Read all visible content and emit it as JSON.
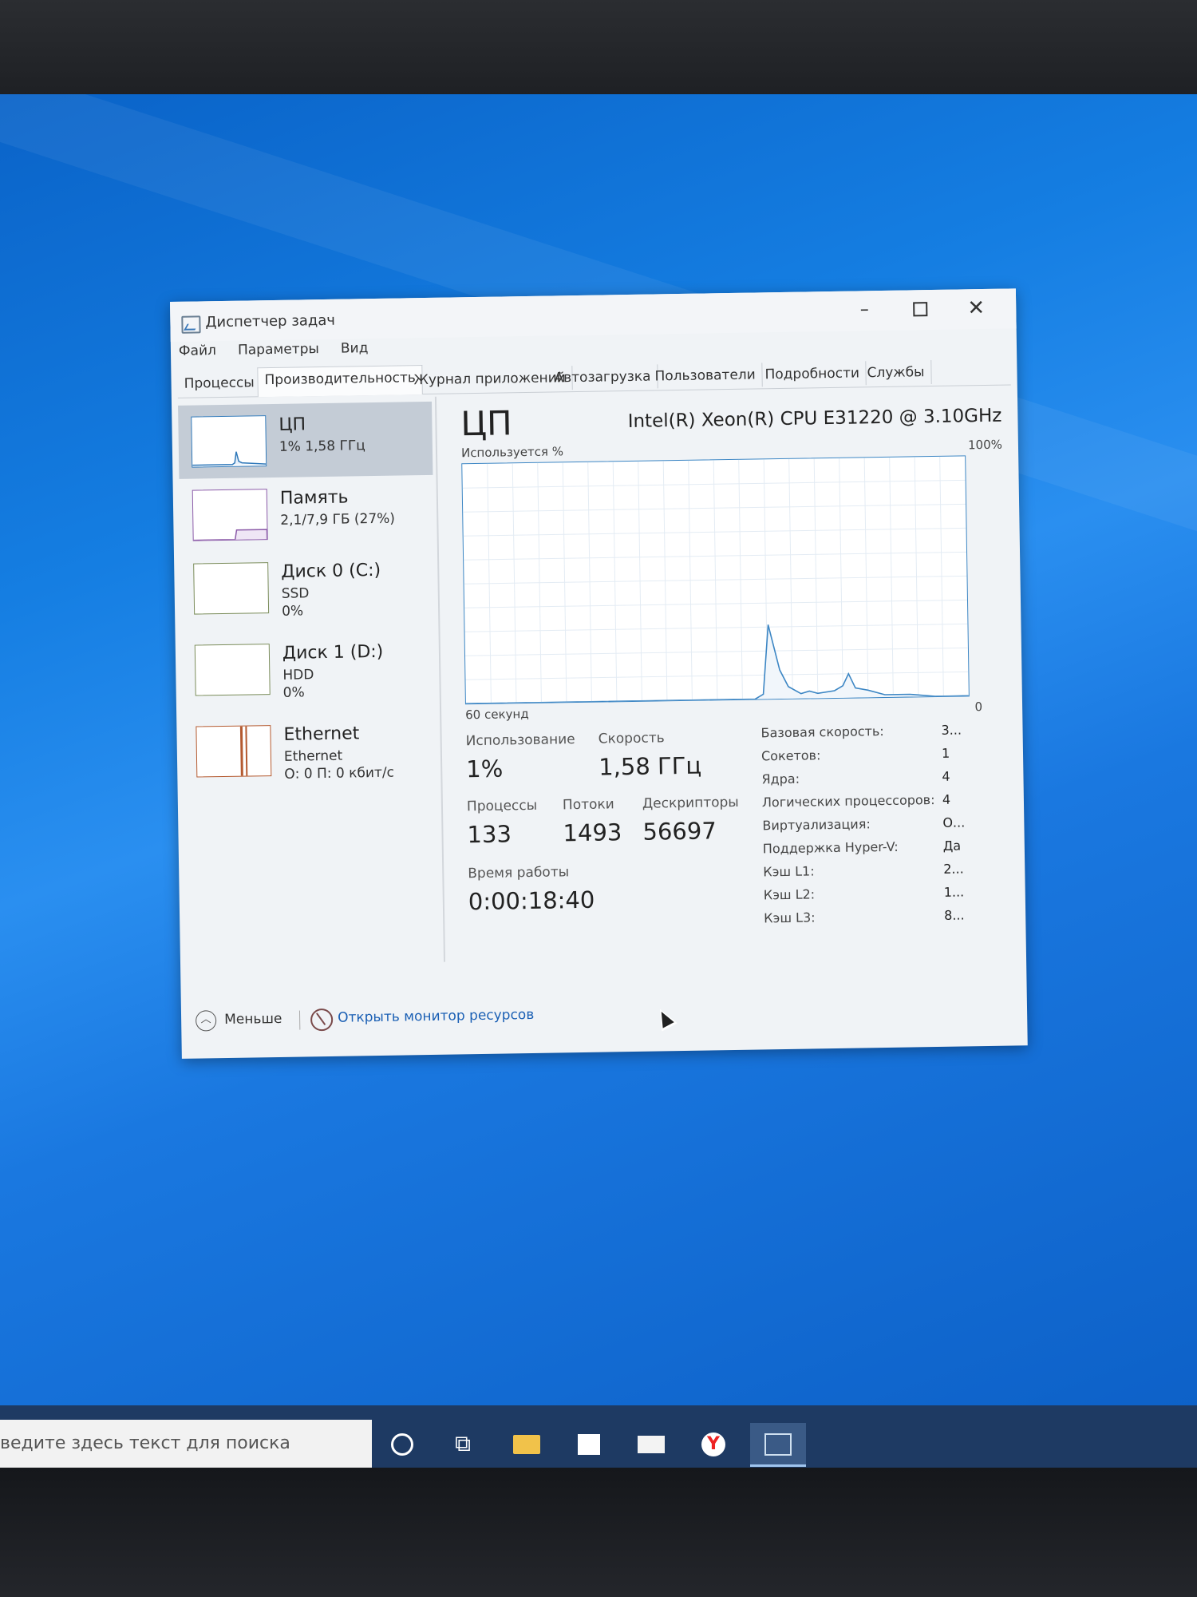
{
  "window": {
    "title": "Диспетчер задач",
    "controls": {
      "minimize": "–",
      "close": "✕"
    }
  },
  "menu": [
    "Файл",
    "Параметры",
    "Вид"
  ],
  "tabs": [
    "Процессы",
    "Производительность",
    "Журнал приложений",
    "Автозагрузка",
    "Пользователи",
    "Подробности",
    "Службы"
  ],
  "active_tab": "Производительность",
  "resources": [
    {
      "name": "ЦП",
      "line2": "1% 1,58 ГГц",
      "line3": ""
    },
    {
      "name": "Память",
      "line2": "2,1/7,9 ГБ (27%)",
      "line3": ""
    },
    {
      "name": "Диск 0 (C:)",
      "line2": "SSD",
      "line3": "0%"
    },
    {
      "name": "Диск 1 (D:)",
      "line2": "HDD",
      "line3": "0%"
    },
    {
      "name": "Ethernet",
      "line2": "Ethernet",
      "line3": "О: 0 П: 0 кбит/с"
    }
  ],
  "cpu": {
    "title": "ЦП",
    "model": "Intel(R) Xeon(R) CPU E31220 @ 3.10GHz",
    "used_label": "Используется %",
    "max_label": "100%",
    "time_label": "60 секунд",
    "min_label": "0"
  },
  "chart_data": {
    "type": "line",
    "x": [
      0,
      2,
      4,
      6,
      8,
      10,
      12,
      14,
      16,
      18,
      20,
      22,
      24,
      26,
      28,
      30,
      32,
      34,
      36,
      38,
      40,
      42,
      44,
      46,
      48,
      50,
      52,
      54,
      56,
      58,
      60
    ],
    "series": [
      {
        "values": [
          0,
          0,
          0,
          0,
          0,
          0,
          0,
          0,
          0,
          0,
          0,
          0,
          0,
          0,
          0,
          0,
          0,
          0,
          0,
          0,
          0,
          0,
          0,
          0,
          0,
          0,
          0,
          0,
          0,
          0,
          0
        ]
      }
    ],
    "detail_points": [
      {
        "x": 0,
        "y": 0
      },
      {
        "x": 34.5,
        "y": 0
      },
      {
        "x": 35.5,
        "y": 2
      },
      {
        "x": 36.2,
        "y": 31
      },
      {
        "x": 37.5,
        "y": 12
      },
      {
        "x": 38.5,
        "y": 5
      },
      {
        "x": 40,
        "y": 2
      },
      {
        "x": 41,
        "y": 3
      },
      {
        "x": 42,
        "y": 2
      },
      {
        "x": 44,
        "y": 3
      },
      {
        "x": 45,
        "y": 5
      },
      {
        "x": 45.7,
        "y": 10
      },
      {
        "x": 46.5,
        "y": 4
      },
      {
        "x": 48,
        "y": 3
      },
      {
        "x": 50,
        "y": 1
      },
      {
        "x": 53,
        "y": 1
      },
      {
        "x": 56,
        "y": 0
      },
      {
        "x": 60,
        "y": 0
      }
    ],
    "ylim": [
      0,
      100
    ],
    "grid": true
  },
  "stats": {
    "usage_label": "Использование",
    "usage_value": "1%",
    "speed_label": "Скорость",
    "speed_value": "1,58 ГГц",
    "processes_label": "Процессы",
    "processes_value": "133",
    "threads_label": "Потоки",
    "threads_value": "1493",
    "handles_label": "Дескрипторы",
    "handles_value": "56697",
    "uptime_label": "Время работы",
    "uptime_value": "0:00:18:40"
  },
  "specs": [
    {
      "label": "Базовая скорость:",
      "value": "3..."
    },
    {
      "label": "Сокетов:",
      "value": "1"
    },
    {
      "label": "Ядра:",
      "value": "4"
    },
    {
      "label": "Логических процессоров:",
      "value": "4"
    },
    {
      "label": "Виртуализация:",
      "value": "О..."
    },
    {
      "label": "Поддержка Hyper-V:",
      "value": "Да"
    },
    {
      "label": "Кэш L1:",
      "value": "2..."
    },
    {
      "label": "Кэш L2:",
      "value": "1..."
    },
    {
      "label": "Кэш L3:",
      "value": "8..."
    }
  ],
  "footer": {
    "less_label": "Меньше",
    "monitor_label": "Открыть монитор ресурсов"
  },
  "taskbar": {
    "search_placeholder": "ведите здесь текст для поиска",
    "icons": [
      "cortana-icon",
      "task-view-icon",
      "file-explorer-icon",
      "store-icon",
      "mail-icon",
      "yandex-browser-icon",
      "task-manager-icon"
    ]
  },
  "colors": {
    "accent": "#2f78b9",
    "graph_line": "#3c86c4",
    "selected_bg": "#c4ccd6",
    "desktop": "#157ee2"
  }
}
